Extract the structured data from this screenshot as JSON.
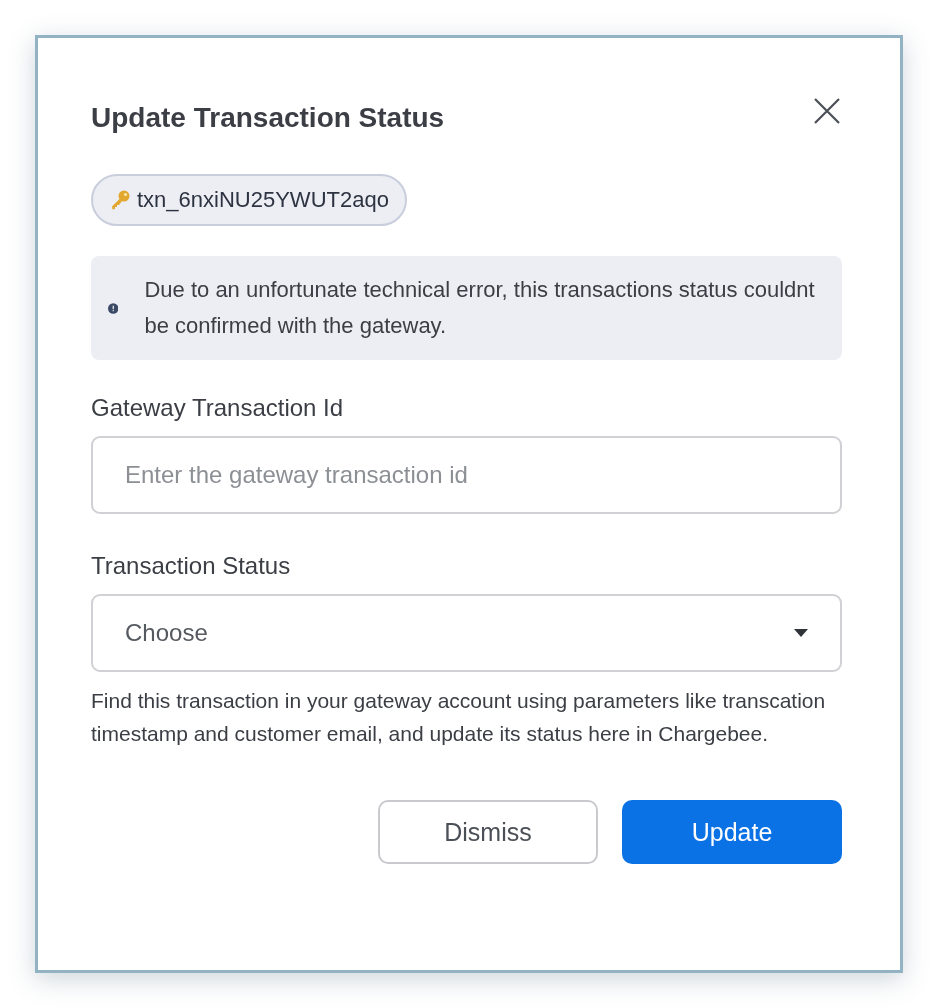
{
  "dialog": {
    "title": "Update Transaction Status",
    "transaction_tag": "txn_6nxiNU25YWUT2aqo",
    "alert": "Due to an unfortunate technical error, this transactions status couldnt be confirmed with the gateway.",
    "fields": [
      {
        "kind": "text",
        "label": "Gateway Transaction Id",
        "placeholder": "Enter the gateway transaction id"
      },
      {
        "kind": "select",
        "label": "Transaction Status",
        "placeholder": "Choose"
      }
    ],
    "help": "Find this transaction in your gateway account using parameters like transcation timestamp and customer email, and update its status here in Chargebee.",
    "buttons": [
      {
        "label": "Dismiss",
        "kind": "secondary"
      },
      {
        "label": "Update",
        "kind": "primary"
      }
    ]
  }
}
